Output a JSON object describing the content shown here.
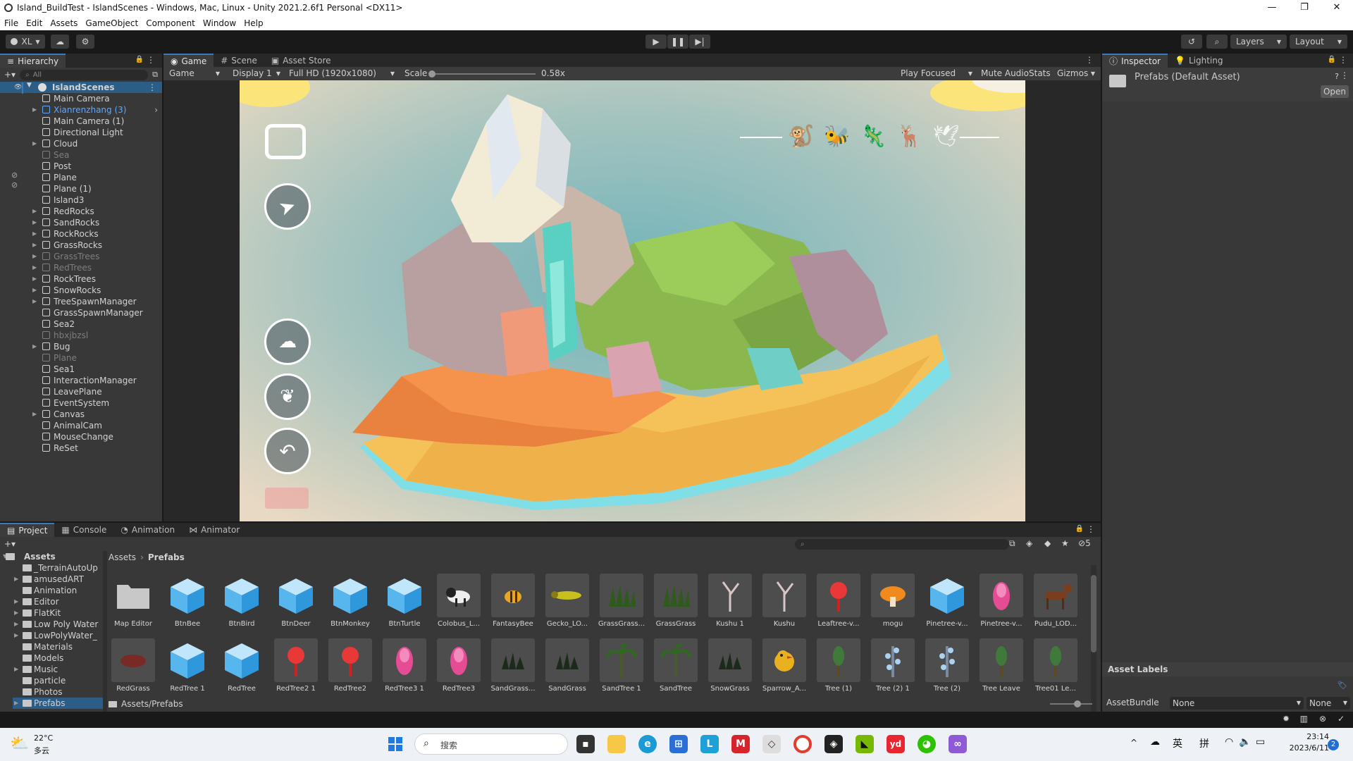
{
  "window": {
    "title": "Island_BuildTest - IslandScenes - Windows, Mac, Linux - Unity 2021.2.6f1 Personal <DX11>",
    "controls": [
      "—",
      "❐",
      "✕"
    ]
  },
  "menu": [
    "File",
    "Edit",
    "Assets",
    "GameObject",
    "Component",
    "Window",
    "Help"
  ],
  "toolbar": {
    "account": "XL",
    "layers_label": "Layers",
    "layout_label": "Layout"
  },
  "hierarchy": {
    "tab_label": "Hierarchy",
    "search_placeholder": "All",
    "scene_name": "IslandScenes",
    "items": [
      {
        "label": "Main Camera",
        "dim": false,
        "sel": false,
        "arrow": false
      },
      {
        "label": "Xianrenzhang (3)",
        "dim": false,
        "sel": true,
        "arrow": true
      },
      {
        "label": "Main Camera (1)",
        "dim": false,
        "sel": false,
        "arrow": false
      },
      {
        "label": "Directional Light",
        "dim": false,
        "sel": false,
        "arrow": false
      },
      {
        "label": "Cloud",
        "dim": false,
        "sel": false,
        "arrow": true
      },
      {
        "label": "Sea",
        "dim": true,
        "sel": false,
        "arrow": false
      },
      {
        "label": "Post",
        "dim": false,
        "sel": false,
        "arrow": false
      },
      {
        "label": "Plane",
        "dim": false,
        "sel": false,
        "arrow": false
      },
      {
        "label": "Plane (1)",
        "dim": false,
        "sel": false,
        "arrow": false
      },
      {
        "label": "Island3",
        "dim": false,
        "sel": false,
        "arrow": false
      },
      {
        "label": "RedRocks",
        "dim": false,
        "sel": false,
        "arrow": true
      },
      {
        "label": "SandRocks",
        "dim": false,
        "sel": false,
        "arrow": true
      },
      {
        "label": "RockRocks",
        "dim": false,
        "sel": false,
        "arrow": true
      },
      {
        "label": "GrassRocks",
        "dim": false,
        "sel": false,
        "arrow": true
      },
      {
        "label": "GrassTrees",
        "dim": true,
        "sel": false,
        "arrow": true
      },
      {
        "label": "RedTrees",
        "dim": true,
        "sel": false,
        "arrow": true
      },
      {
        "label": "RockTrees",
        "dim": false,
        "sel": false,
        "arrow": true
      },
      {
        "label": "SnowRocks",
        "dim": false,
        "sel": false,
        "arrow": true
      },
      {
        "label": "TreeSpawnManager",
        "dim": false,
        "sel": false,
        "arrow": true
      },
      {
        "label": "GrassSpawnManager",
        "dim": false,
        "sel": false,
        "arrow": false
      },
      {
        "label": "Sea2",
        "dim": false,
        "sel": false,
        "arrow": false
      },
      {
        "label": "hbxjbzsl",
        "dim": true,
        "sel": false,
        "arrow": false
      },
      {
        "label": "Bug",
        "dim": false,
        "sel": false,
        "arrow": true
      },
      {
        "label": "Plane",
        "dim": true,
        "sel": false,
        "arrow": false
      },
      {
        "label": "Sea1",
        "dim": false,
        "sel": false,
        "arrow": false
      },
      {
        "label": "InteractionManager",
        "dim": false,
        "sel": false,
        "arrow": false
      },
      {
        "label": "LeavePlane",
        "dim": false,
        "sel": false,
        "arrow": false
      },
      {
        "label": "EventSystem",
        "dim": false,
        "sel": false,
        "arrow": false
      },
      {
        "label": "Canvas",
        "dim": false,
        "sel": false,
        "arrow": true
      },
      {
        "label": "AnimalCam",
        "dim": false,
        "sel": false,
        "arrow": false
      },
      {
        "label": "MouseChange",
        "dim": false,
        "sel": false,
        "arrow": false
      },
      {
        "label": "ReSet",
        "dim": false,
        "sel": false,
        "arrow": false
      }
    ]
  },
  "game": {
    "tabs": [
      "Game",
      "Scene",
      "Asset Store"
    ],
    "mode": "Game",
    "display": "Display 1",
    "resolution": "Full HD (1920x1080)",
    "scale_label": "Scale",
    "scale_value": "0.58x",
    "play_focused": "Play Focused",
    "mute_audio": "Mute Audio",
    "stats": "Stats",
    "gizmos": "Gizmos"
  },
  "inspector": {
    "tabs": [
      "Inspector",
      "Lighting"
    ],
    "asset_title": "Prefabs (Default Asset)",
    "open_button": "Open",
    "asset_labels": "Asset Labels",
    "assetbundle_label": "AssetBundle",
    "assetbundle_value": "None",
    "variant_value": "None"
  },
  "project": {
    "tabs": [
      "Project",
      "Console",
      "Animation",
      "Animator"
    ],
    "breadcrumb_root": "Assets",
    "breadcrumb_current": "Prefabs",
    "footer_path": "Assets/Prefabs",
    "hidden_count": "5",
    "root_folder": "Assets",
    "folders": [
      "_TerrainAutoUp",
      "amusedART",
      "Animation",
      "Editor",
      "FlatKit",
      "Low Poly Water",
      "LowPolyWater_",
      "Materials",
      "Models",
      "Music",
      "particle",
      "Photos",
      "Prefabs"
    ],
    "assets_row1": [
      {
        "label": "Map Editor",
        "kind": "folder"
      },
      {
        "label": "BtnBee",
        "kind": "cube"
      },
      {
        "label": "BtnBird",
        "kind": "cube"
      },
      {
        "label": "BtnDeer",
        "kind": "cube"
      },
      {
        "label": "BtnMonkey",
        "kind": "cube"
      },
      {
        "label": "BtnTurtle",
        "kind": "cube"
      },
      {
        "label": "Colobus_L...",
        "kind": "monkey"
      },
      {
        "label": "FantasyBee",
        "kind": "bee"
      },
      {
        "label": "Gecko_LO...",
        "kind": "gecko"
      },
      {
        "label": "GrassGrass...",
        "kind": "grass"
      },
      {
        "label": "GrassGrass",
        "kind": "grass"
      },
      {
        "label": "Kushu 1",
        "kind": "deadtree"
      },
      {
        "label": "Kushu",
        "kind": "deadtree"
      },
      {
        "label": "Leaftree-v...",
        "kind": "redtree"
      },
      {
        "label": "mogu",
        "kind": "mushroom"
      },
      {
        "label": "Pinetree-v...",
        "kind": "cube"
      },
      {
        "label": "Pinetree-v...",
        "kind": "pinktree"
      },
      {
        "label": "Pudu_LOD...",
        "kind": "deer"
      }
    ],
    "assets_row2": [
      {
        "label": "RedGrass",
        "kind": "redgrass"
      },
      {
        "label": "RedTree 1",
        "kind": "cube"
      },
      {
        "label": "RedTree",
        "kind": "cube"
      },
      {
        "label": "RedTree2 1",
        "kind": "redtree"
      },
      {
        "label": "RedTree2",
        "kind": "redtree"
      },
      {
        "label": "RedTree3 1",
        "kind": "pinktree"
      },
      {
        "label": "RedTree3",
        "kind": "pinktree"
      },
      {
        "label": "SandGrass...",
        "kind": "darkgrass"
      },
      {
        "label": "SandGrass",
        "kind": "darkgrass"
      },
      {
        "label": "SandTree 1",
        "kind": "palm"
      },
      {
        "label": "SandTree",
        "kind": "palm"
      },
      {
        "label": "SnowGrass",
        "kind": "darkgrass"
      },
      {
        "label": "Sparrow_A...",
        "kind": "bird"
      },
      {
        "label": "Tree (1)",
        "kind": "greentree"
      },
      {
        "label": "Tree (2) 1",
        "kind": "bluetree"
      },
      {
        "label": "Tree (2)",
        "kind": "bluetree"
      },
      {
        "label": "Tree Leave",
        "kind": "greentree"
      },
      {
        "label": "Tree01 Le...",
        "kind": "greentree"
      }
    ]
  },
  "taskbar": {
    "weather_temp": "22°C",
    "weather_desc": "多云",
    "search_placeholder": "搜索",
    "ime_lang": "英",
    "ime_mode": "拼",
    "time": "23:14",
    "date": "2023/6/11",
    "notification_count": "2"
  },
  "colors": {
    "accent": "#3a79bb",
    "selection": "#5fa8ff",
    "panel": "#383838",
    "header": "#282828"
  }
}
